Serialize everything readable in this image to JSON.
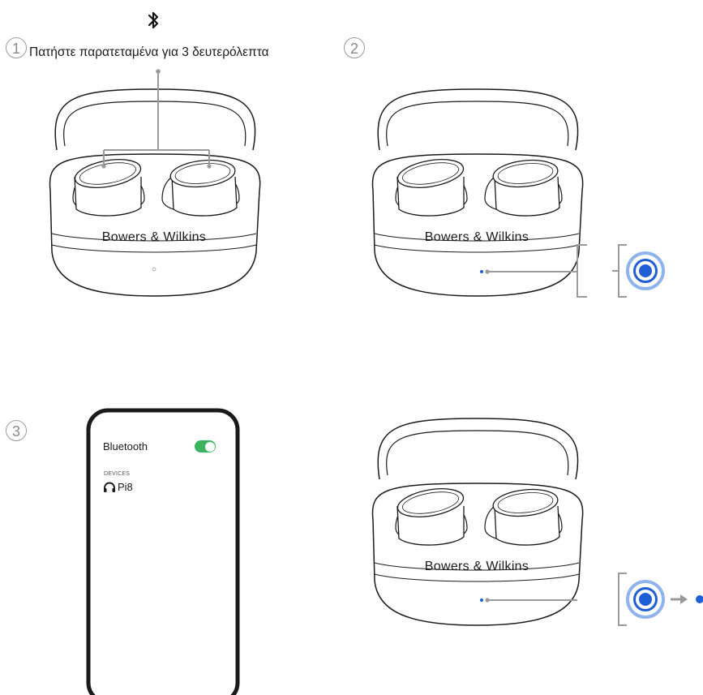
{
  "steps": {
    "step1": {
      "number": "1",
      "instruction": "Πατήστε παρατεταμένα για 3 δευτερόλεπτα"
    },
    "step2": {
      "number": "2"
    },
    "step3": {
      "number": "3"
    }
  },
  "case": {
    "brand": "Bowers & Wilkins"
  },
  "phone": {
    "bluetooth_label": "Bluetooth",
    "bluetooth_enabled": true,
    "devices_header": "DEVICES",
    "device_name": "Pi8",
    "device_icon": "headphones-icon"
  },
  "colors": {
    "led_blue": "#1f5fd6",
    "led_ring": "#8fb3ec",
    "toggle_green": "#3cb35e",
    "line_gray": "#9a9a9a"
  },
  "icons": [
    "bluetooth-icon",
    "led-indicator-icon",
    "arrow-right-icon",
    "headphones-icon"
  ]
}
